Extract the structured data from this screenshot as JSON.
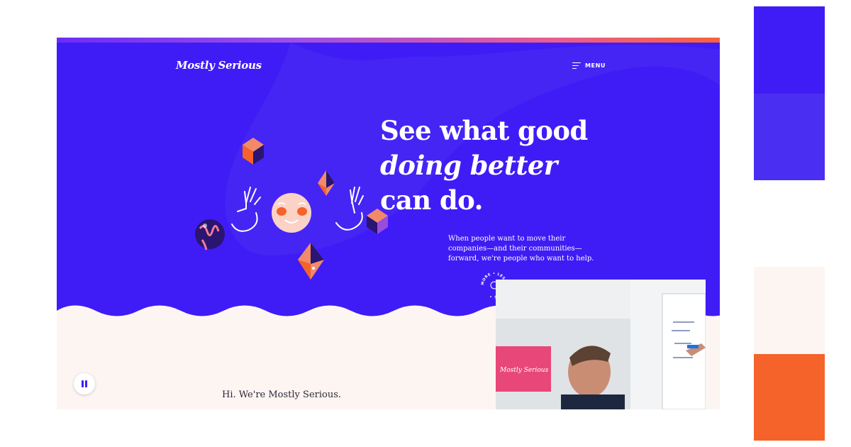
{
  "site": {
    "logo_text": "Mostly Serious",
    "menu_label": "MENU"
  },
  "hero": {
    "headline_line1": "See what good",
    "headline_line2": "doing better",
    "headline_line3": "can do.",
    "subtext": "When people want to move their companies—and their communities—forward, we're people who want to help.",
    "badge_text": "MORE • LESS • MORE •"
  },
  "intro": {
    "greeting": "Hi. We're Mostly Serious."
  },
  "photo": {
    "screen_text": "Mostly Serious"
  },
  "colors": {
    "brand_blue": "#3f1cf6",
    "blue_light": "#4a2ef2",
    "cream": "#fdf5f2",
    "orange": "#f5622a"
  },
  "palette": [
    "#3f1cf6",
    "#4a2ef2",
    "#fdf5f2",
    "#f5622a"
  ]
}
